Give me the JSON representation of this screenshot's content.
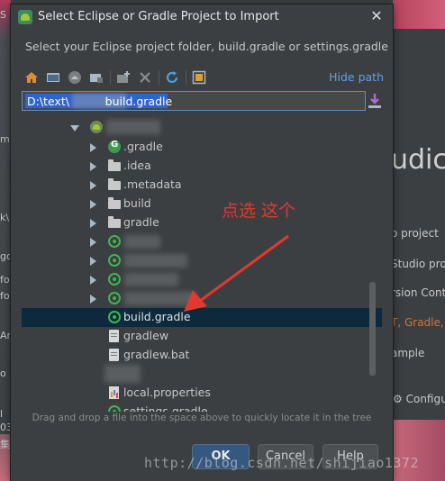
{
  "dialog": {
    "title": "Select Eclipse or Gradle Project to Import",
    "description": "Select your Eclipse project folder, build.gradle or settings.gradle",
    "hide_path_label": "Hide path",
    "path_value": "D:\\text\\          build.gradle",
    "hint": "Drag and drop a file into the space above to quickly locate it in the tree",
    "buttons": {
      "ok": "OK",
      "cancel": "Cancel",
      "help": "Help"
    }
  },
  "tree": {
    "items": [
      {
        "label": ".gradle",
        "icon": "gradle-icon"
      },
      {
        "label": ".idea",
        "icon": "folder-icon"
      },
      {
        "label": ".metadata",
        "icon": "folder-icon"
      },
      {
        "label": "build",
        "icon": "folder-icon"
      },
      {
        "label": "gradle",
        "icon": "folder-icon"
      },
      {
        "label": "build.gradle",
        "icon": "gradle-sync-icon",
        "selected": true
      },
      {
        "label": "gradlew",
        "icon": "file-icon"
      },
      {
        "label": "gradlew.bat",
        "icon": "file-icon"
      },
      {
        "label": "local.properties",
        "icon": "properties-file-icon"
      },
      {
        "label": "settings.gradle",
        "icon": "gradle-sync-icon"
      }
    ]
  },
  "annotation": {
    "text": "点选 这个",
    "color": "#e03a2e"
  },
  "background_app": {
    "title_fragment": "udic",
    "items": [
      "o project",
      "Studio pro",
      "rsion Cont",
      "T, Gradle,",
      "ample",
      "Configu"
    ],
    "left_fragments": [
      "S",
      "m",
      "k\\",
      "go",
      "fo",
      "fo",
      "Ar",
      "o",
      "l",
      "03",
      "集"
    ]
  },
  "watermark": "http://blog.csdn.net/shijiao1372",
  "colors": {
    "selection": "#0d293e",
    "link": "#5f9fe6",
    "ok_button": "#365880",
    "path_highlight": "#2f65ca"
  }
}
